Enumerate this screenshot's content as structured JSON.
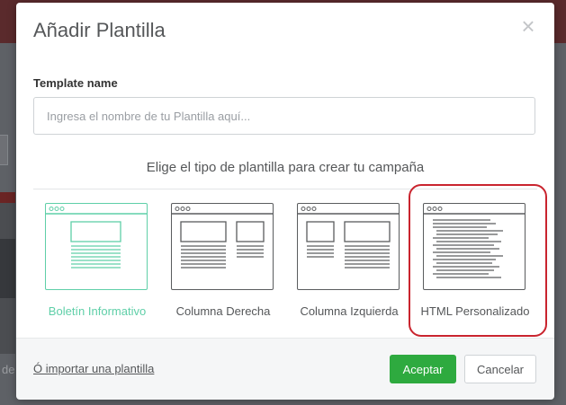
{
  "background": {
    "partial_text": "de"
  },
  "modal": {
    "title": "Añadir Plantilla",
    "close_glyph": "×",
    "template_name_label": "Template name",
    "template_name_placeholder": "Ingresa el nombre de tu Plantilla aquí...",
    "template_name_value": "",
    "choose_prompt": "Elige el tipo de plantilla para crear tu campaña",
    "template_types": [
      {
        "label": "Boletín Informativo",
        "icon": "newsletter-layout-icon",
        "selected": true
      },
      {
        "label": "Columna Derecha",
        "icon": "right-column-layout-icon",
        "selected": false
      },
      {
        "label": "Columna Izquierda",
        "icon": "left-column-layout-icon",
        "selected": false
      },
      {
        "label": "HTML Personalizado",
        "icon": "custom-html-layout-icon",
        "selected": false,
        "highlighted": true
      }
    ],
    "footer": {
      "import_link": "Ó importar una plantilla",
      "accept_label": "Aceptar",
      "cancel_label": "Cancelar"
    }
  },
  "colors": {
    "selected_accent": "#5fcfa8",
    "accept_button": "#2eaa3f",
    "highlight_ring": "#c9242e",
    "topbar": "#5a2a2c"
  }
}
